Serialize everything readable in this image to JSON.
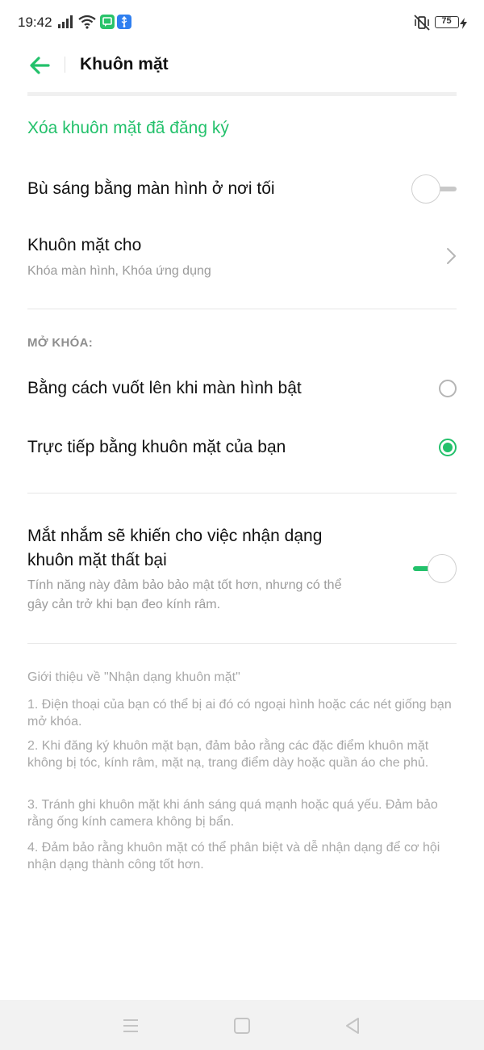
{
  "status_bar": {
    "time": "19:42",
    "battery": "75",
    "icons": [
      "signal-icon",
      "wifi-icon",
      "message-notification-icon",
      "usb-notification-icon",
      "vibrate-off-icon",
      "battery-icon",
      "charging-icon"
    ]
  },
  "header": {
    "title": "Khuôn mặt",
    "back_icon": "arrow-left-icon"
  },
  "actions": {
    "delete_face": "Xóa khuôn mặt đã đăng ký"
  },
  "settings": {
    "screen_fill_light": {
      "label": "Bù sáng bằng màn hình ở nơi tối",
      "enabled": false
    },
    "face_for": {
      "label": "Khuôn mặt cho",
      "value": "Khóa màn hình, Khóa ứng dụng"
    },
    "unlock_section_header": "MỞ KHÓA:",
    "unlock_options": [
      {
        "label": "Bằng cách vuốt lên khi màn hình bật",
        "selected": false
      },
      {
        "label": "Trực tiếp bằng khuôn mặt của bạn",
        "selected": true
      }
    ],
    "eyes_closed": {
      "label_line1": "Mắt nhắm sẽ khiến cho việc nhận dạng",
      "label_line2": "khuôn mặt thất bại",
      "description_line1": "Tính năng này đảm bảo bảo mật tốt hơn, nhưng có thể",
      "description_line2": "gây cản trở khi bạn đeo kính râm.",
      "enabled": true
    }
  },
  "info": {
    "title": "Giới thiệu về \"Nhận dạng khuôn mặt\"",
    "items": [
      "1. Điện thoại của bạn có thể bị ai đó có ngoại hình hoặc các nét giống bạn mở khóa.",
      "2. Khi đăng ký khuôn mặt bạn, đảm bảo rằng các đặc điểm khuôn mặt không bị tóc, kính râm, mặt nạ, trang điểm dày hoặc quần áo che phủ.",
      "3. Tránh ghi khuôn mặt khi ánh sáng quá mạnh hoặc quá yếu. Đảm bảo rằng ống kính camera không bị bẩn.",
      "4. Đảm bảo rằng khuôn mặt có thể phân biệt và dễ nhận dạng để cơ hội nhận dạng thành công tốt hơn."
    ]
  },
  "colors": {
    "accent": "#23c16b",
    "secondary_text": "#9b9b9b",
    "divider": "#e6e6e6"
  },
  "nav_bar": {
    "icons": [
      "menu-icon",
      "home-icon",
      "back-triangle-icon"
    ]
  }
}
